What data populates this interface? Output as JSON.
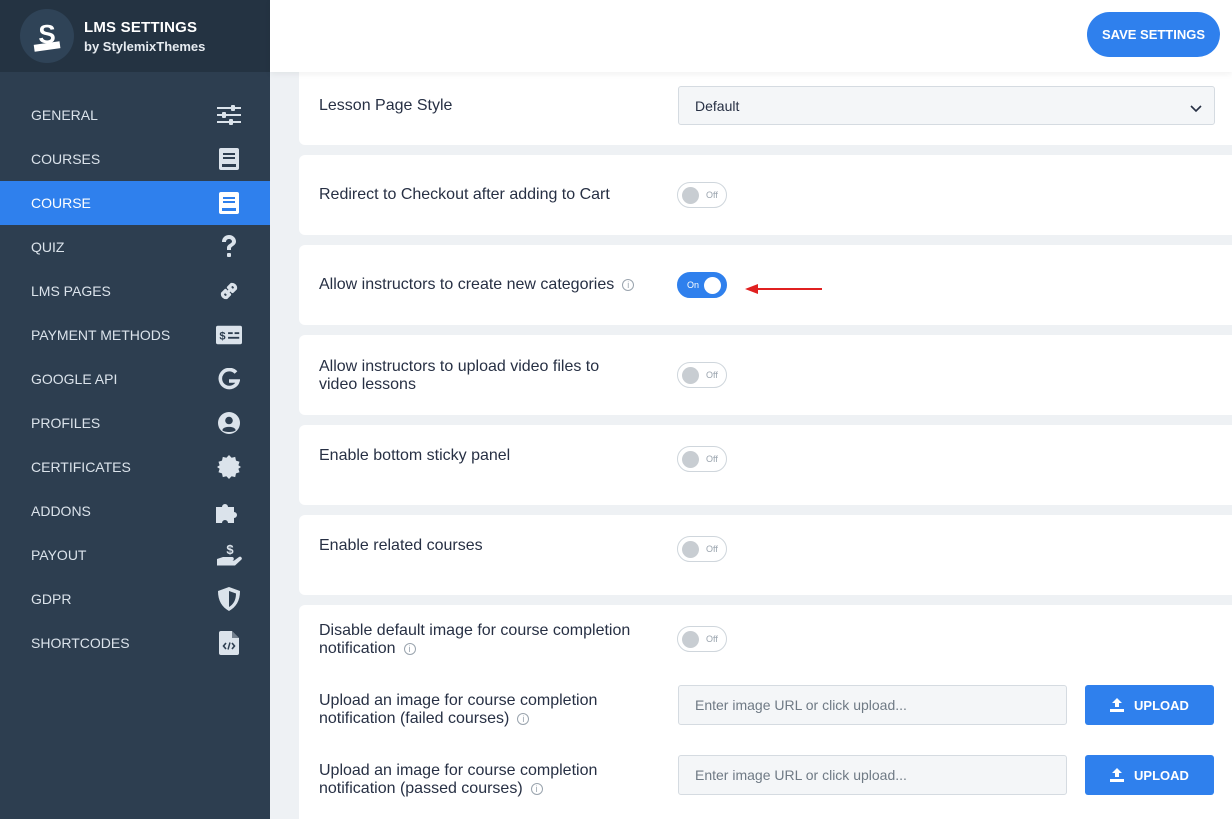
{
  "brand": {
    "title": "LMS SETTINGS",
    "subtitle": "by StylemixThemes"
  },
  "header": {
    "save_label": "SAVE SETTINGS"
  },
  "sidebar": {
    "items": [
      {
        "label": "GENERAL",
        "icon": "sliders-icon"
      },
      {
        "label": "COURSES",
        "icon": "book-icon"
      },
      {
        "label": "COURSE",
        "icon": "book-open-icon",
        "active": true
      },
      {
        "label": "QUIZ",
        "icon": "question-icon"
      },
      {
        "label": "LMS PAGES",
        "icon": "link-icon"
      },
      {
        "label": "PAYMENT METHODS",
        "icon": "money-bill-icon"
      },
      {
        "label": "GOOGLE API",
        "icon": "google-icon"
      },
      {
        "label": "PROFILES",
        "icon": "user-circle-icon"
      },
      {
        "label": "CERTIFICATES",
        "icon": "certificate-icon"
      },
      {
        "label": "ADDONS",
        "icon": "puzzle-icon"
      },
      {
        "label": "PAYOUT",
        "icon": "hand-dollar-icon"
      },
      {
        "label": "GDPR",
        "icon": "shield-icon"
      },
      {
        "label": "SHORTCODES",
        "icon": "file-code-icon"
      }
    ]
  },
  "settings": {
    "lesson_style": {
      "label": "Lesson Page Style",
      "value": "Default"
    },
    "redirect_checkout": {
      "label": "Redirect to Checkout after adding to Cart",
      "state": "Off"
    },
    "instructor_categories": {
      "label": "Allow instructors to create new categories",
      "state": "On"
    },
    "instructor_video": {
      "label_line1": "Allow instructors to upload video files to",
      "label_line2": "video lessons",
      "state": "Off"
    },
    "sticky_panel": {
      "label": "Enable bottom sticky panel",
      "state": "Off"
    },
    "related_courses": {
      "label": "Enable related courses",
      "state": "Off"
    },
    "disable_default_image": {
      "label_line1": "Disable default image for course completion",
      "label_line2": "notification",
      "state": "Off"
    },
    "upload_failed": {
      "label_line1": "Upload an image for course completion",
      "label_line2": "notification (failed courses)",
      "placeholder": "Enter image URL or click upload...",
      "button": "UPLOAD"
    },
    "upload_passed": {
      "label_line1": "Upload an image for course completion",
      "label_line2": "notification (passed courses)",
      "placeholder": "Enter image URL or click upload...",
      "button": "UPLOAD"
    }
  },
  "colors": {
    "accent": "#2f80ed",
    "sidebar": "#2d3e50",
    "sidebar_dark": "#243342",
    "annotation_arrow": "#e02020"
  }
}
